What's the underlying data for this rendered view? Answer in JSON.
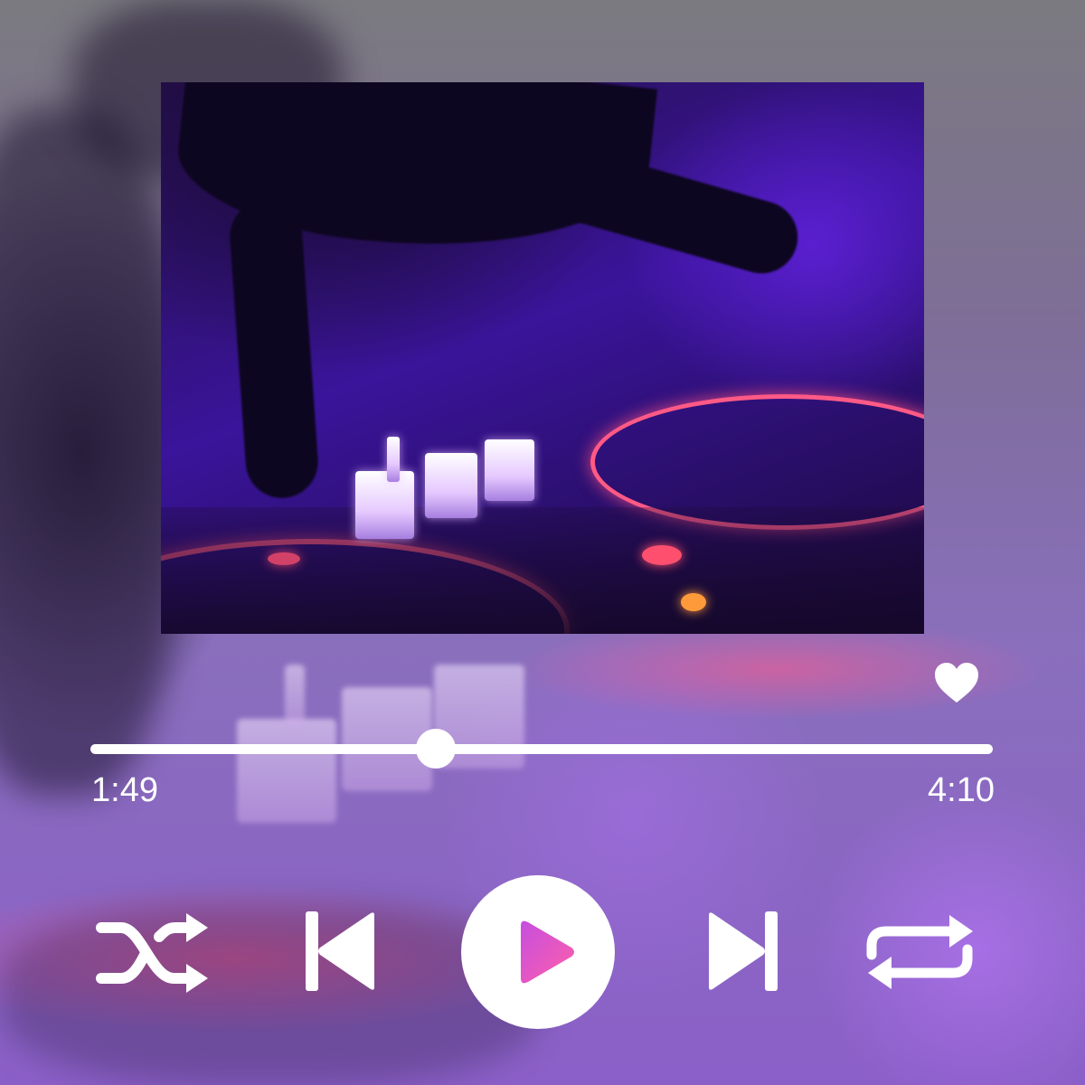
{
  "player": {
    "elapsed": "1:49",
    "total": "4:10",
    "progress_fraction": 0.3825,
    "favorited": true
  },
  "controls": {
    "shuffle_icon": "shuffle-icon",
    "previous_icon": "skip-previous-icon",
    "play_icon": "play-icon",
    "next_icon": "skip-next-icon",
    "repeat_icon": "repeat-icon",
    "favorite_icon": "heart-icon"
  },
  "colors": {
    "foreground": "#ffffff",
    "play_triangle_start": "#d24fd6",
    "play_triangle_end": "#ff5fa8",
    "accent_glow": "#ff5a86"
  }
}
